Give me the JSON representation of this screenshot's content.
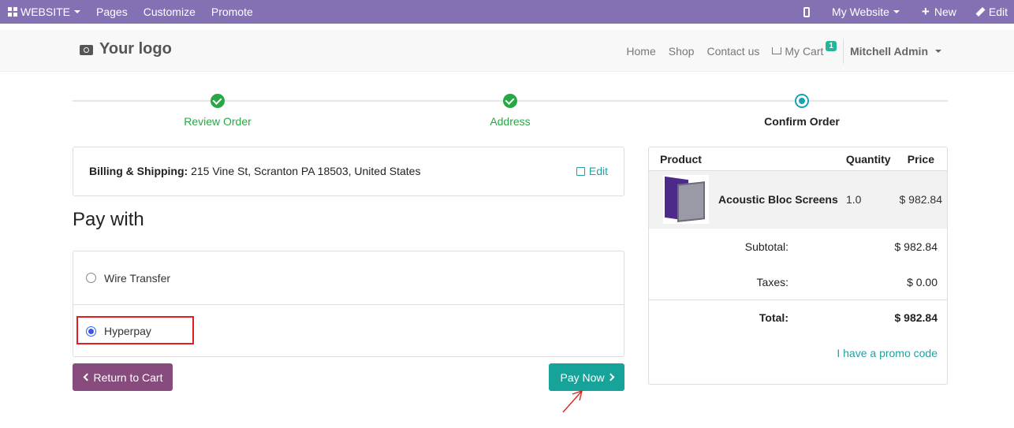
{
  "topbar": {
    "website": "WEBSITE",
    "pages": "Pages",
    "customize": "Customize",
    "promote": "Promote",
    "my_website": "My Website",
    "new": "New",
    "edit": "Edit"
  },
  "header": {
    "logo": "Your logo",
    "nav": [
      "Home",
      "Shop",
      "Contact us"
    ],
    "cart_label": "My Cart",
    "cart_count": "1",
    "user": "Mitchell Admin"
  },
  "steps": [
    {
      "label": "Review Order",
      "state": "done"
    },
    {
      "label": "Address",
      "state": "done"
    },
    {
      "label": "Confirm Order",
      "state": "current"
    }
  ],
  "billing": {
    "label": "Billing & Shipping:",
    "address": "215 Vine St, Scranton PA 18503, United States",
    "edit": "Edit"
  },
  "pay_with": "Pay with",
  "methods": [
    {
      "label": "Wire Transfer",
      "selected": false
    },
    {
      "label": "Hyperpay",
      "selected": true
    }
  ],
  "buttons": {
    "return": "Return to Cart",
    "pay": "Pay Now"
  },
  "summary": {
    "headers": {
      "product": "Product",
      "quantity": "Quantity",
      "price": "Price"
    },
    "item": {
      "name": "Acoustic Bloc Screens",
      "qty": "1.0",
      "price": "$ 982.84"
    },
    "subtotal_label": "Subtotal:",
    "subtotal": "$ 982.84",
    "taxes_label": "Taxes:",
    "taxes": "$ 0.00",
    "total_label": "Total:",
    "total": "$ 982.84",
    "promo": "I have a promo code"
  },
  "colors": {
    "topbar": "#8471b3",
    "success": "#28a745",
    "accent": "#20a2a2",
    "return_btn": "#874b7e",
    "pay_btn": "#16a39a",
    "highlight": "#e02020"
  }
}
